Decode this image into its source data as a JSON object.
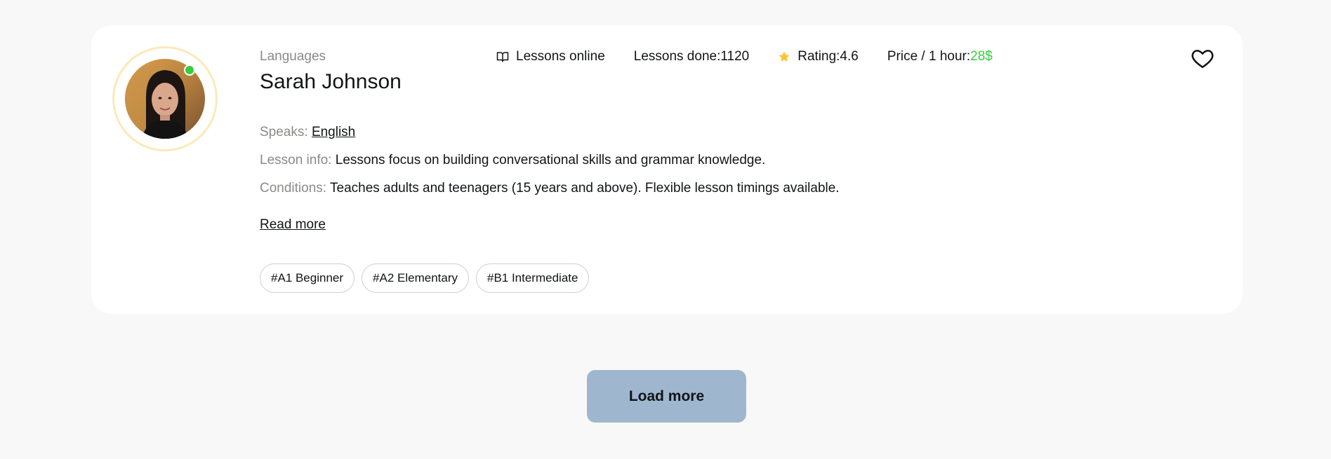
{
  "teacher": {
    "category": "Languages",
    "name": "Sarah Johnson",
    "online": true,
    "stats": {
      "lessons_online": "Lessons online",
      "lessons_done_label": "Lessons done: ",
      "lessons_done_value": "1120",
      "rating_label": "Rating: ",
      "rating_value": "4.6",
      "price_label": "Price / 1 hour: ",
      "price_value": "28$"
    },
    "speaks_label": "Speaks:",
    "speaks_value": "English",
    "lesson_info_label": "Lesson info:",
    "lesson_info_value": "Lessons focus on building conversational skills and grammar knowledge.",
    "conditions_label": "Conditions:",
    "conditions_value": "Teaches adults and teenagers (15 years and above). Flexible lesson timings available.",
    "read_more": "Read more",
    "tags": [
      "#A1 Beginner",
      "#A2 Elementary",
      "#B1 Intermediate"
    ]
  },
  "load_more": "Load more",
  "colors": {
    "accent_green": "#38cd3e",
    "avatar_ring": "#fbe9ba",
    "button_bg": "#9fb7ce",
    "star": "#ffc531"
  },
  "icons": {
    "book": "book-open-icon",
    "star": "star-icon",
    "heart": "heart-icon"
  }
}
